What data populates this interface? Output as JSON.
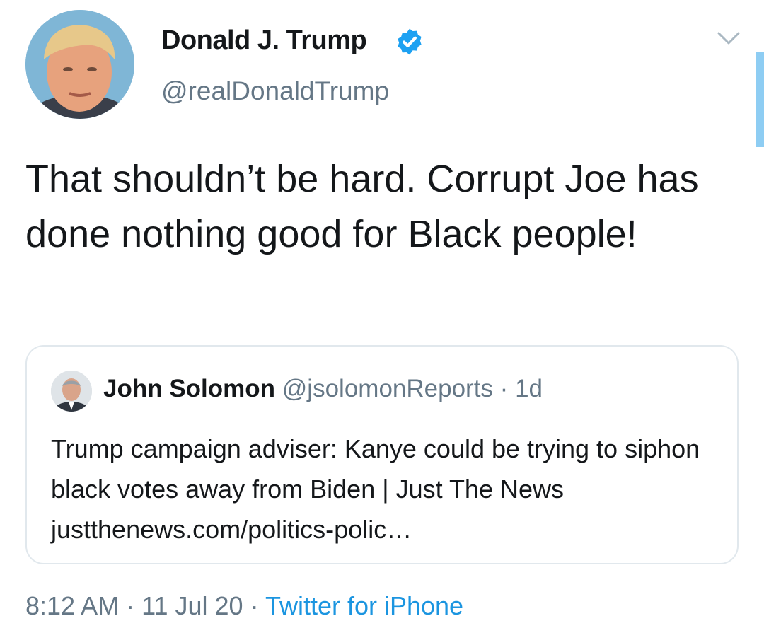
{
  "author": {
    "name": "Donald J. Trump",
    "handle": "@realDonaldTrump",
    "verified": true,
    "avatar_icon": "profile-photo"
  },
  "tweet": {
    "text": "That shouldn’t be hard. Corrupt Joe has done nothing good for Black people!"
  },
  "quoted_tweet": {
    "name": "John Solomon",
    "handle": "@jsolomonReports",
    "separator": "·",
    "time": "1d",
    "text": "Trump campaign adviser: Kanye could be trying to siphon black votes away from Biden | Just The News justthenews.com/politics-polic…"
  },
  "meta": {
    "time": "8:12 AM",
    "sep1": "·",
    "date": "11 Jul 20",
    "sep2": "·",
    "source": "Twitter for iPhone"
  },
  "colors": {
    "text": "#14171a",
    "secondary": "#657786",
    "accent": "#1b95e0",
    "border": "#e1e8ed"
  },
  "icons": {
    "verified": "verified-badge-icon",
    "menu": "chevron-down-icon"
  }
}
